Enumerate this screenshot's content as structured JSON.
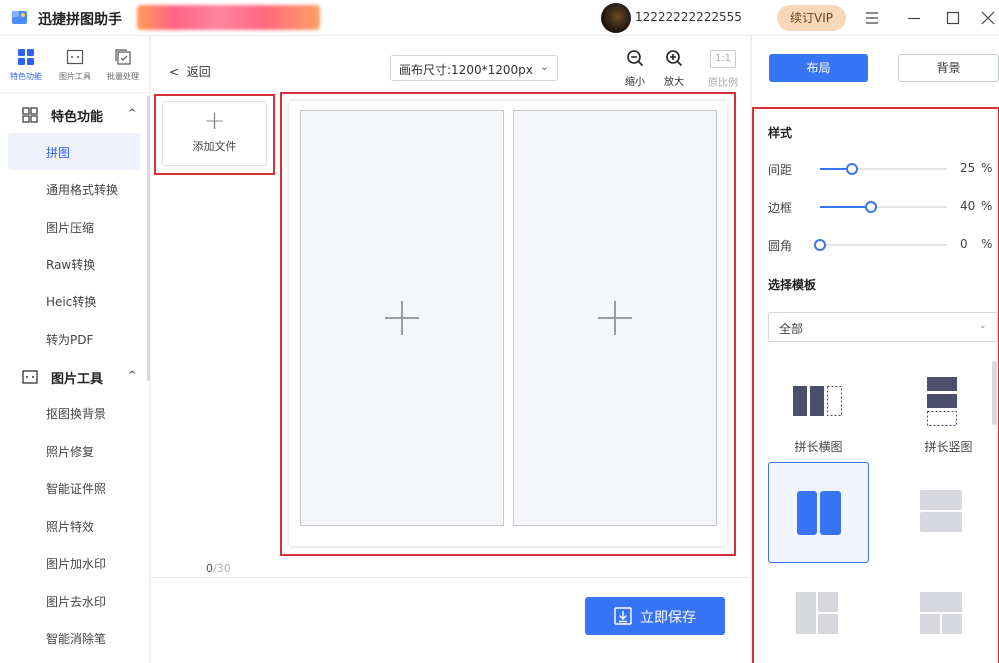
{
  "titlebar": {
    "app_title": "迅捷拼图助手",
    "phone": "12222222222555",
    "vip_label": "续订VIP"
  },
  "leftnav": {
    "top_tabs": [
      {
        "label": "特色功能",
        "icon": "feature-grid-icon"
      },
      {
        "label": "图片工具",
        "icon": "image-tool-icon"
      },
      {
        "label": "批量处理",
        "icon": "batch-process-icon"
      }
    ],
    "groups": [
      {
        "label": "特色功能",
        "icon": "feature-grid-icon"
      },
      {
        "label": "图片工具",
        "icon": "image-tool-icon"
      }
    ],
    "items": [
      "拼图",
      "通用格式转换",
      "图片压缩",
      "Raw转换",
      "Heic转换",
      "转为PDF",
      "抠图换背景",
      "照片修复",
      "智能证件照",
      "照片特效",
      "图片加水印",
      "图片去水印",
      "智能消除笔"
    ],
    "active_item": "拼图"
  },
  "center": {
    "back_label": "返回",
    "canvas_size": "画布尺寸:1200*1200px",
    "zoom_out_label": "缩小",
    "zoom_in_label": "放大",
    "ratio_button": "1:1",
    "ratio_label": "原比例",
    "add_file_label": "添加文件",
    "count_current": "0",
    "count_max": "/30",
    "save_label": "立即保存"
  },
  "right": {
    "tab_layout": "布局",
    "tab_background": "背景",
    "style_title": "样式",
    "sliders": [
      {
        "label": "间距",
        "value": "25",
        "unit": "%",
        "fraction": 0.25
      },
      {
        "label": "边框",
        "value": "40",
        "unit": "%",
        "fraction": 0.4
      },
      {
        "label": "圆角",
        "value": "0",
        "unit": "%",
        "fraction": 0.0
      }
    ],
    "template_title": "选择模板",
    "template_filter": "全部",
    "templates": [
      {
        "label": "拼长横图"
      },
      {
        "label": "拼长竖图"
      }
    ]
  },
  "colors": {
    "accent": "#3874f6",
    "highlight_border": "#d6303b",
    "vip_bg": "#f7d8b8"
  }
}
